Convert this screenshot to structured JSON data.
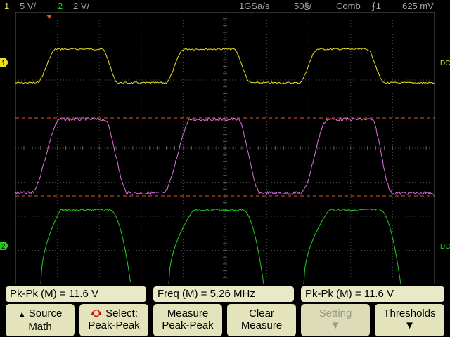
{
  "status": {
    "ch1_num": "1",
    "ch1_scale": "5 V/",
    "ch2_num": "2",
    "ch2_scale": "2 V/",
    "sample_rate": "1GSa/s",
    "timebase": "50§/",
    "acq_mode": "Comb",
    "trigger": "⨍1",
    "trigger_level": "625 mV"
  },
  "screen": {
    "ch1_marker": "1",
    "ch2_marker": "2",
    "ch1_coupling": "DC",
    "ch2_coupling": "DC",
    "math_color": "#e070e0",
    "ch1_color": "#e8e020",
    "ch2_color": "#20d020",
    "cursor_color": "#e05a28"
  },
  "measurements": [
    {
      "label": "Pk-Pk (M)  =  11.6  V"
    },
    {
      "label": "Freq (M)  =  5.26 MHz"
    },
    {
      "label": "Pk-Pk (M)  =  11.6  V"
    }
  ],
  "softkeys": {
    "source_l1": "Source",
    "source_l2": "Math",
    "select_l1": "Select:",
    "select_l2": "Peak-Peak",
    "measure_l1": "Measure",
    "measure_l2": "Peak-Peak",
    "clear_l1": "Clear",
    "clear_l2": "Measure",
    "setting_l1": "Setting",
    "thresholds_l1": "Thresholds"
  }
}
